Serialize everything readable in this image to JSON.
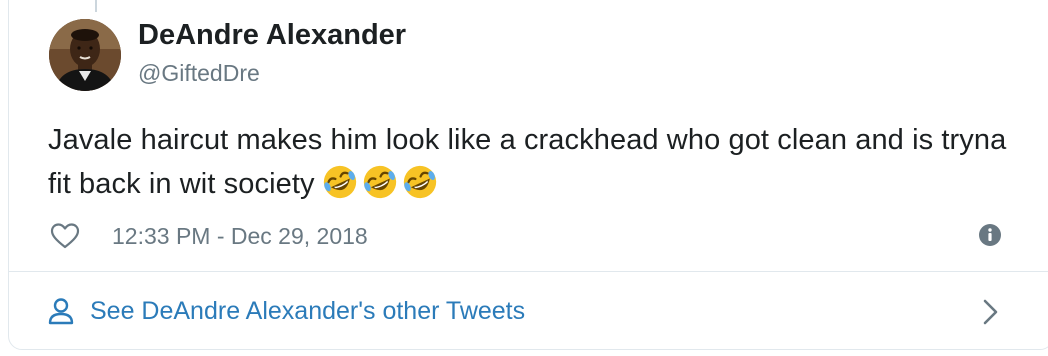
{
  "author": {
    "name": "DeAndre Alexander",
    "handle": "@GiftedDre",
    "avatar_icon": "profile-photo"
  },
  "tweet": {
    "text": "Javale haircut makes him look like a crackhead who got clean and is tryna fit back  in wit society",
    "emojis": [
      "rolling-on-the-floor-laughing",
      "rolling-on-the-floor-laughing",
      "rolling-on-the-floor-laughing"
    ],
    "timestamp": "12:33 PM - Dec 29, 2018"
  },
  "actions": {
    "like_icon": "heart-icon",
    "info_icon": "info-icon"
  },
  "footer": {
    "label": "See DeAndre Alexander's other Tweets",
    "icon": "person-icon",
    "chevron": "chevron-right-icon"
  },
  "colors": {
    "text": "#1c2022",
    "secondary": "#697882",
    "link": "#2b7bb9",
    "border": "#e1e8ed"
  }
}
